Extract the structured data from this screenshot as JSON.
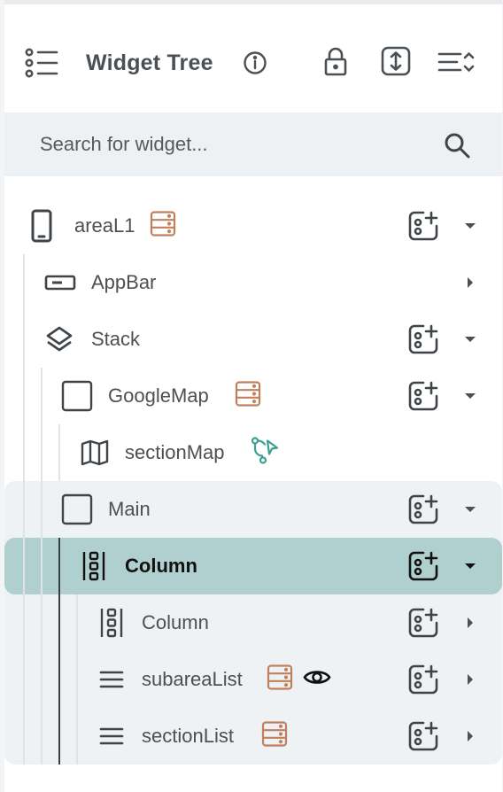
{
  "header": {
    "title": "Widget Tree",
    "icons": [
      "tree-list-icon",
      "info-icon",
      "lock-icon",
      "expand-vertical-icon",
      "collapse-all-icon"
    ]
  },
  "search": {
    "placeholder": "Search for widget..."
  },
  "tree": {
    "items": [
      {
        "label": "areaL1",
        "icon": "phone-icon",
        "badge": "backend-query-icon"
      },
      {
        "label": "AppBar",
        "icon": "appbar-icon"
      },
      {
        "label": "Stack",
        "icon": "layers-icon"
      },
      {
        "label": "GoogleMap",
        "icon": "square-icon",
        "badge": "backend-query-icon"
      },
      {
        "label": "sectionMap",
        "icon": "map-icon",
        "badge": "action-flow-icon"
      },
      {
        "label": "Main",
        "icon": "square-icon"
      },
      {
        "label": "Column",
        "icon": "column-icon",
        "selected": true
      },
      {
        "label": "Column",
        "icon": "column-icon"
      },
      {
        "label": "subareaList",
        "icon": "list-icon",
        "badge": "backend-query-icon",
        "extra": "visibility-icon"
      },
      {
        "label": "sectionList",
        "icon": "list-icon",
        "badge": "backend-query-icon"
      }
    ]
  },
  "colors": {
    "selected_row": "#b0cfcf",
    "hover_group": "#eff2f4",
    "badge_orange": "#c0805c",
    "flow_teal": "#3aa08f"
  }
}
